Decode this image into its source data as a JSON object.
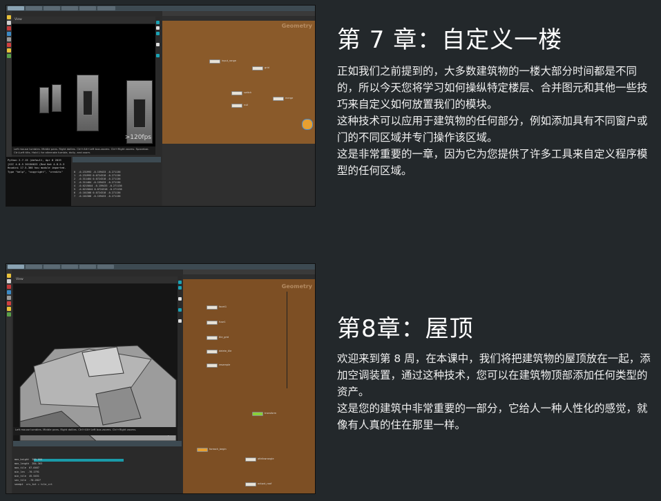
{
  "chapters": [
    {
      "title": "第 7 章：自定义一楼",
      "paragraphs": [
        "正如我们之前提到的，大多数建筑物的一楼大部分时间都是不同的，所以今天您将学习如何操纵特定楼层、合并图元和其他一些技巧来自定义如何放置我们的模块。",
        "这种技术可以应用于建筑物的任何部分，例如添加具有不同窗户或门的不同区域并专门操作该区域。",
        "这是非常重要的一章，因为它为您提供了许多工具来自定义程序模型的任何区域。"
      ]
    },
    {
      "title": "第8章：屋顶",
      "paragraphs": [
        "欢迎来到第 8 周，在本课中，我们将把建筑物的屋顶放在一起，添加空调装置，通过这种技术，您可以在建筑物顶部添加任何类型的资产。",
        "这是您的建筑中非常重要的一部分，它给人一种人性化的感觉，就像有人真的住在那里一样。"
      ]
    }
  ],
  "screens": {
    "shot1": {
      "viewport_label": "View",
      "fps": ">120fps",
      "network_label": "Geometry",
      "nodes": [
        "input_range",
        "grid",
        "switch",
        "null",
        "merge"
      ],
      "console_lines": [
        "Python 2.7.15 (default, Apr  8 2019",
        "[GCC 4.8.5 20150623 (Red Hat 4.8.5-3",
        "Houdini 17.5.360 hou module imported.",
        "Type \"help\", \"copyright\", \"credits\""
      ],
      "spread_rows": [
        [
          "0",
          "-0.231993",
          "-0.159433",
          "-0.271136"
        ],
        [
          "1",
          "-0.231993",
          "0.0724318",
          "-0.271136"
        ],
        [
          "2",
          "-0.311484",
          "0.0724318",
          "-0.271136"
        ],
        [
          "3",
          "-0.311484",
          "-0.159433",
          "-0.271136"
        ],
        [
          "4",
          "-0.0215844",
          "-0.159433",
          "-0.271136"
        ],
        [
          "5",
          "-0.0215844",
          "0.0724318",
          "-0.271136"
        ],
        [
          "6",
          "-0.101308",
          "0.0724318",
          "-0.271136"
        ],
        [
          "7",
          "-0.101308",
          "-0.159433",
          "-0.271136"
        ]
      ],
      "status_text": "Left mouse tumbles. Middle pans. Right dollies. Ctrl+Alt+Left box-zooms. Ctrl+Right zooms. Spacebar-Ctrl-Left tilts. Hold L for alternate tumble, dolly, and zoom."
    },
    "shot2": {
      "viewport_label": "View",
      "fps": ">120fps",
      "network_label": "Geometry",
      "nodes": [
        "facet1",
        "fuse1",
        "tile_grid",
        "delete_tile",
        "resample",
        "transform",
        "foreach_begin",
        "attribwrangle",
        "output_roof"
      ],
      "spread_rows": [
        [
          "max_height",
          "200.000"
        ],
        [
          "max_length",
          "284.363"
        ],
        [
          "max_tile",
          "67.6467"
        ],
        [
          "min_len",
          "-70.1791"
        ],
        [
          "min_tile",
          "45.5451"
        ],
        [
          "sec_tile",
          "-70.2827"
        ],
        [
          "seedpt",
          "crs_tot = tile_crt"
        ]
      ],
      "status_text": "Left mouse tumbles. Middle pans. Right dollies. Ctrl+Alt+Left box-zooms. Ctrl+Right zooms."
    }
  }
}
